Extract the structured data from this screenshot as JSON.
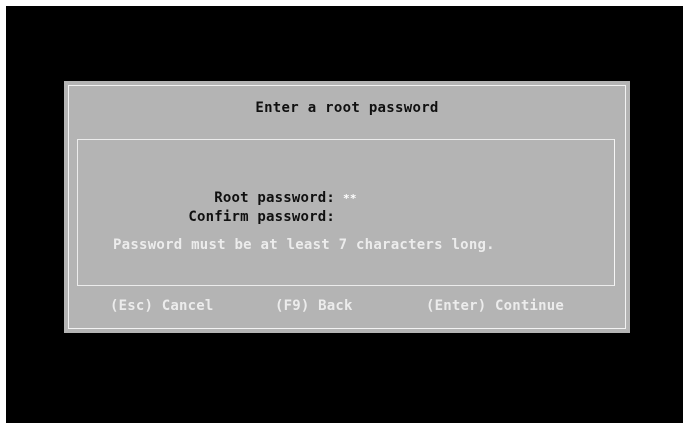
{
  "dialog": {
    "title": "Enter a root password",
    "fields": [
      {
        "label": "Root password:",
        "value": "**"
      },
      {
        "label": "Confirm password:",
        "value": ""
      }
    ],
    "hint": "Password must be at least 7 characters long."
  },
  "actions": {
    "cancel": "(Esc) Cancel",
    "back": "(F9) Back",
    "continue": "(Enter) Continue"
  },
  "colors": {
    "screen_background": "#000000",
    "dialog_background": "#b4b4b4",
    "dialog_text": "#101010",
    "highlight_text": "#ececec"
  }
}
